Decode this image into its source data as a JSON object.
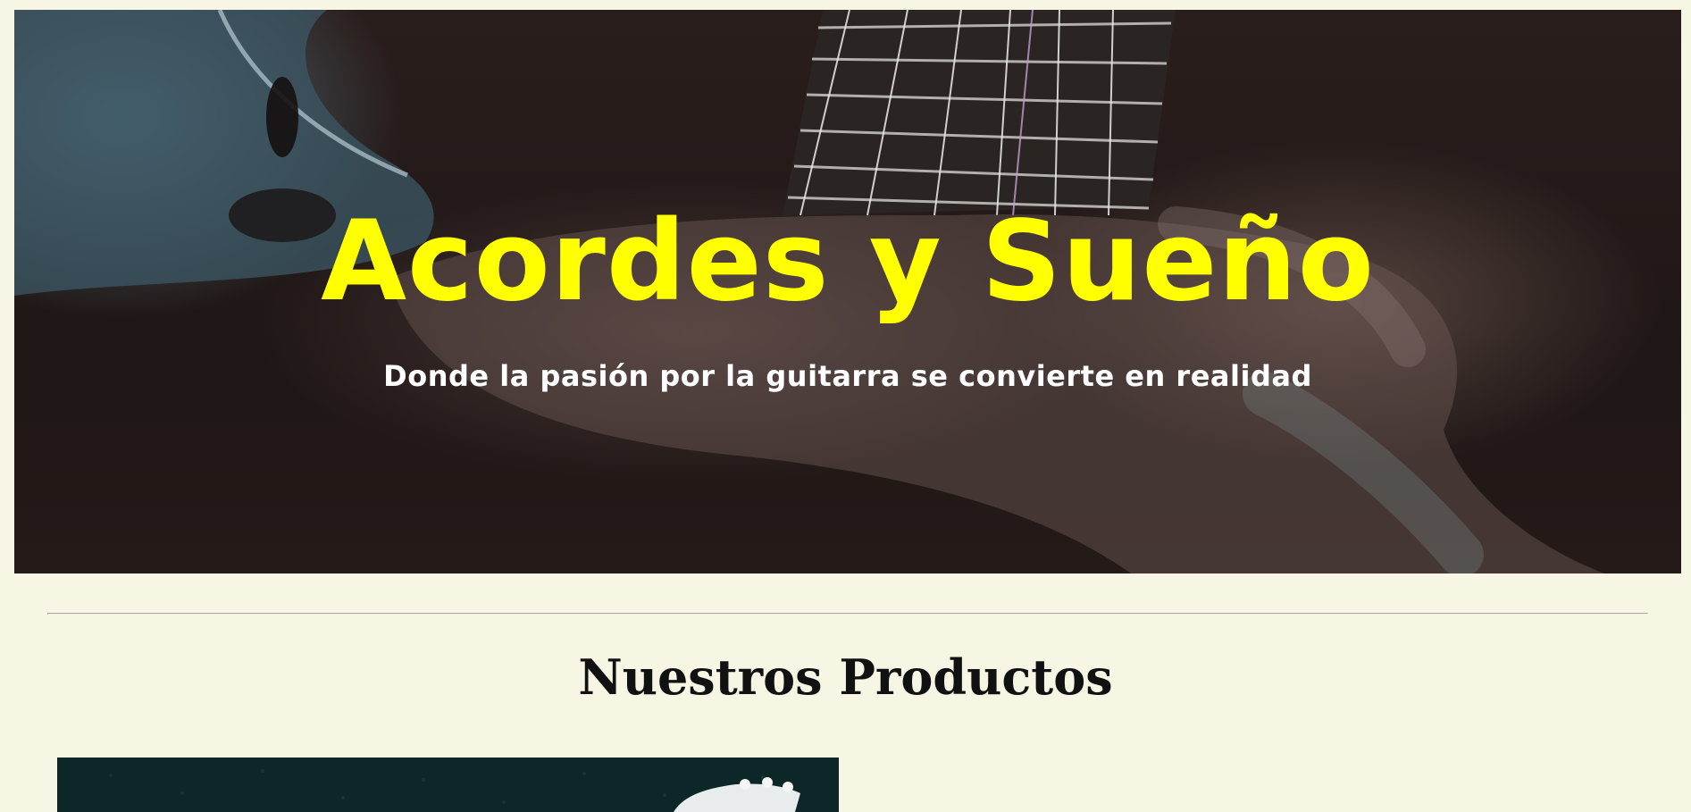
{
  "hero": {
    "title": "Acordes y Sueño",
    "subtitle": "Donde la pasión por la guitarra se convierte en realidad",
    "image": "guitar-closeup-photo"
  },
  "products": {
    "heading": "Nuestros Productos",
    "first_item_image": "guitar-headstock-photo"
  },
  "colors": {
    "page_background": "#f7f5e4",
    "hero_title": "#ffff00",
    "hero_subtitle": "#ffffff",
    "heading": "#111111"
  }
}
